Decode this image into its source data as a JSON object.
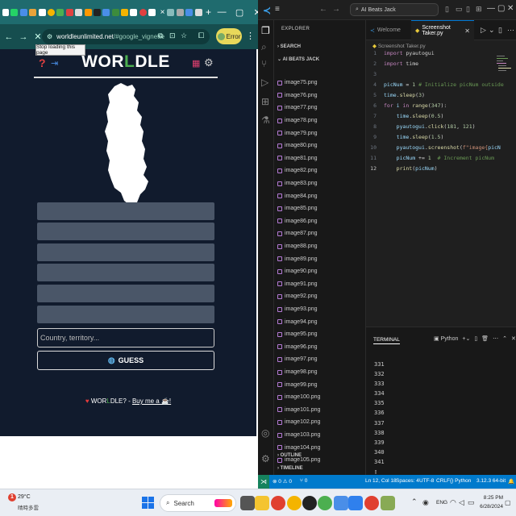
{
  "chrome": {
    "url_host": "worldleunlimited.net",
    "url_path": "/#google_vignette",
    "error_label": "Error",
    "tooltip": "Stop loading this page",
    "tab_close": "×",
    "new_tab": "+",
    "colors": {
      "frame": "#1f6b6e",
      "toolbar": "#164e4f"
    }
  },
  "worldle": {
    "title_a": "WOR",
    "title_l": "L",
    "title_b": "DLE",
    "input_placeholder": "Country, territory...",
    "guess_label": "GUESS",
    "footer_brand_a": "WOR",
    "footer_brand_l": "L",
    "footer_brand_b": "DLE?",
    "footer_sep": " - ",
    "footer_link": "Buy me a ☕!",
    "colors": {
      "background": "#111b2d",
      "row": "#4a5668",
      "accent": "#4caf50"
    }
  },
  "vscode": {
    "search_text": "AI Beats Jack",
    "explorer_label": "EXPLORER",
    "search_section": "SEARCH",
    "folder_label": "AI BEATS JACK",
    "outline_label": "OUTLINE",
    "timeline_label": "TIMELINE",
    "files": [
      "image75.png",
      "image76.png",
      "image77.png",
      "image78.png",
      "image79.png",
      "image80.png",
      "image81.png",
      "image82.png",
      "image83.png",
      "image84.png",
      "image85.png",
      "image86.png",
      "image87.png",
      "image88.png",
      "image89.png",
      "image90.png",
      "image91.png",
      "image92.png",
      "image93.png",
      "image94.png",
      "image95.png",
      "image96.png",
      "image97.png",
      "image98.png",
      "image99.png",
      "image100.png",
      "image101.png",
      "image102.png",
      "image103.png",
      "image104.png",
      "image105.png"
    ],
    "tabs": {
      "welcome": "Welcome",
      "active": "Screenshot Taker.py"
    },
    "breadcrumb": "Screenshot Taker.py",
    "line_numbers": [
      "1",
      "2",
      "3",
      "4",
      "5",
      "6",
      "7",
      "8",
      "9",
      "10",
      "11",
      "12"
    ],
    "current_line": "12",
    "terminal_label": "TERMINAL",
    "terminal_shell": "Python",
    "terminal_lines": [
      "331",
      "332",
      "333",
      "334",
      "335",
      "336",
      "337",
      "338",
      "339",
      "340",
      "341"
    ],
    "status": {
      "errors": "0",
      "warnings": "0",
      "ports": "0",
      "position": "Ln 12, Col 18",
      "spaces": "Spaces: 4",
      "encoding": "UTF-8",
      "eol": "CRLF",
      "language": "Python",
      "interpreter": "3.12.3 64-bit"
    }
  },
  "taskbar": {
    "temperature": "29°C",
    "weather": "晴時多雲",
    "weather_badge": "1",
    "search_label": "Search",
    "lang": "ENG",
    "time": "8:25 PM",
    "date": "6/28/2024"
  }
}
